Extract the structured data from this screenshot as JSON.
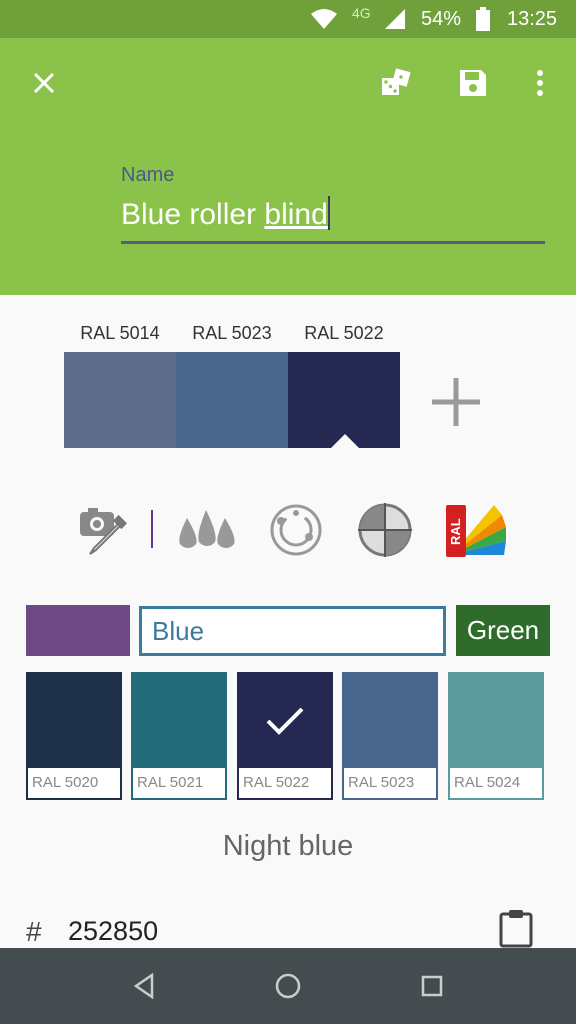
{
  "status_bar": {
    "network": "4G",
    "battery": "54%",
    "time": "13:25"
  },
  "toolbar": {
    "close_icon": "close-icon",
    "dice_icon": "dice-icon",
    "save_icon": "save-icon",
    "more_icon": "more-vertical-icon"
  },
  "name_field": {
    "label": "Name",
    "value_plain": "Blue roller ",
    "value_underlined": "blind"
  },
  "palette": {
    "swatches": [
      {
        "label": "RAL 5014",
        "color": "#5e6b8b"
      },
      {
        "label": "RAL 5023",
        "color": "#49668c"
      },
      {
        "label": "RAL 5022",
        "color": "#252850"
      }
    ],
    "selected_index": 2
  },
  "tools": [
    "eyedropper-camera-icon",
    "drops-icon",
    "color-wheel-icon",
    "contrast-target-icon",
    "ral-fan-icon"
  ],
  "search": {
    "current_color": "#6e4a85",
    "query": "Blue",
    "filter_label": "Green",
    "filter_color": "#2f6b2a"
  },
  "colors": [
    {
      "code": "RAL 5020",
      "color": "#1e2f48",
      "border": "#1e2f48"
    },
    {
      "code": "RAL 5021",
      "color": "#236b78",
      "border": "#236b78"
    },
    {
      "code": "RAL 5022",
      "color": "#252850",
      "border": "#252850",
      "selected": true
    },
    {
      "code": "RAL 5023",
      "color": "#49668c",
      "border": "#49668c"
    },
    {
      "code": "RAL 5024",
      "color": "#5a9a9a",
      "border": "#5a9a9a"
    }
  ],
  "selected_color": {
    "name": "Night blue",
    "hash": "#",
    "hex": "252850",
    "copy_icon": "clipboard-icon"
  },
  "nav": [
    "back-icon",
    "home-icon",
    "recents-icon"
  ]
}
